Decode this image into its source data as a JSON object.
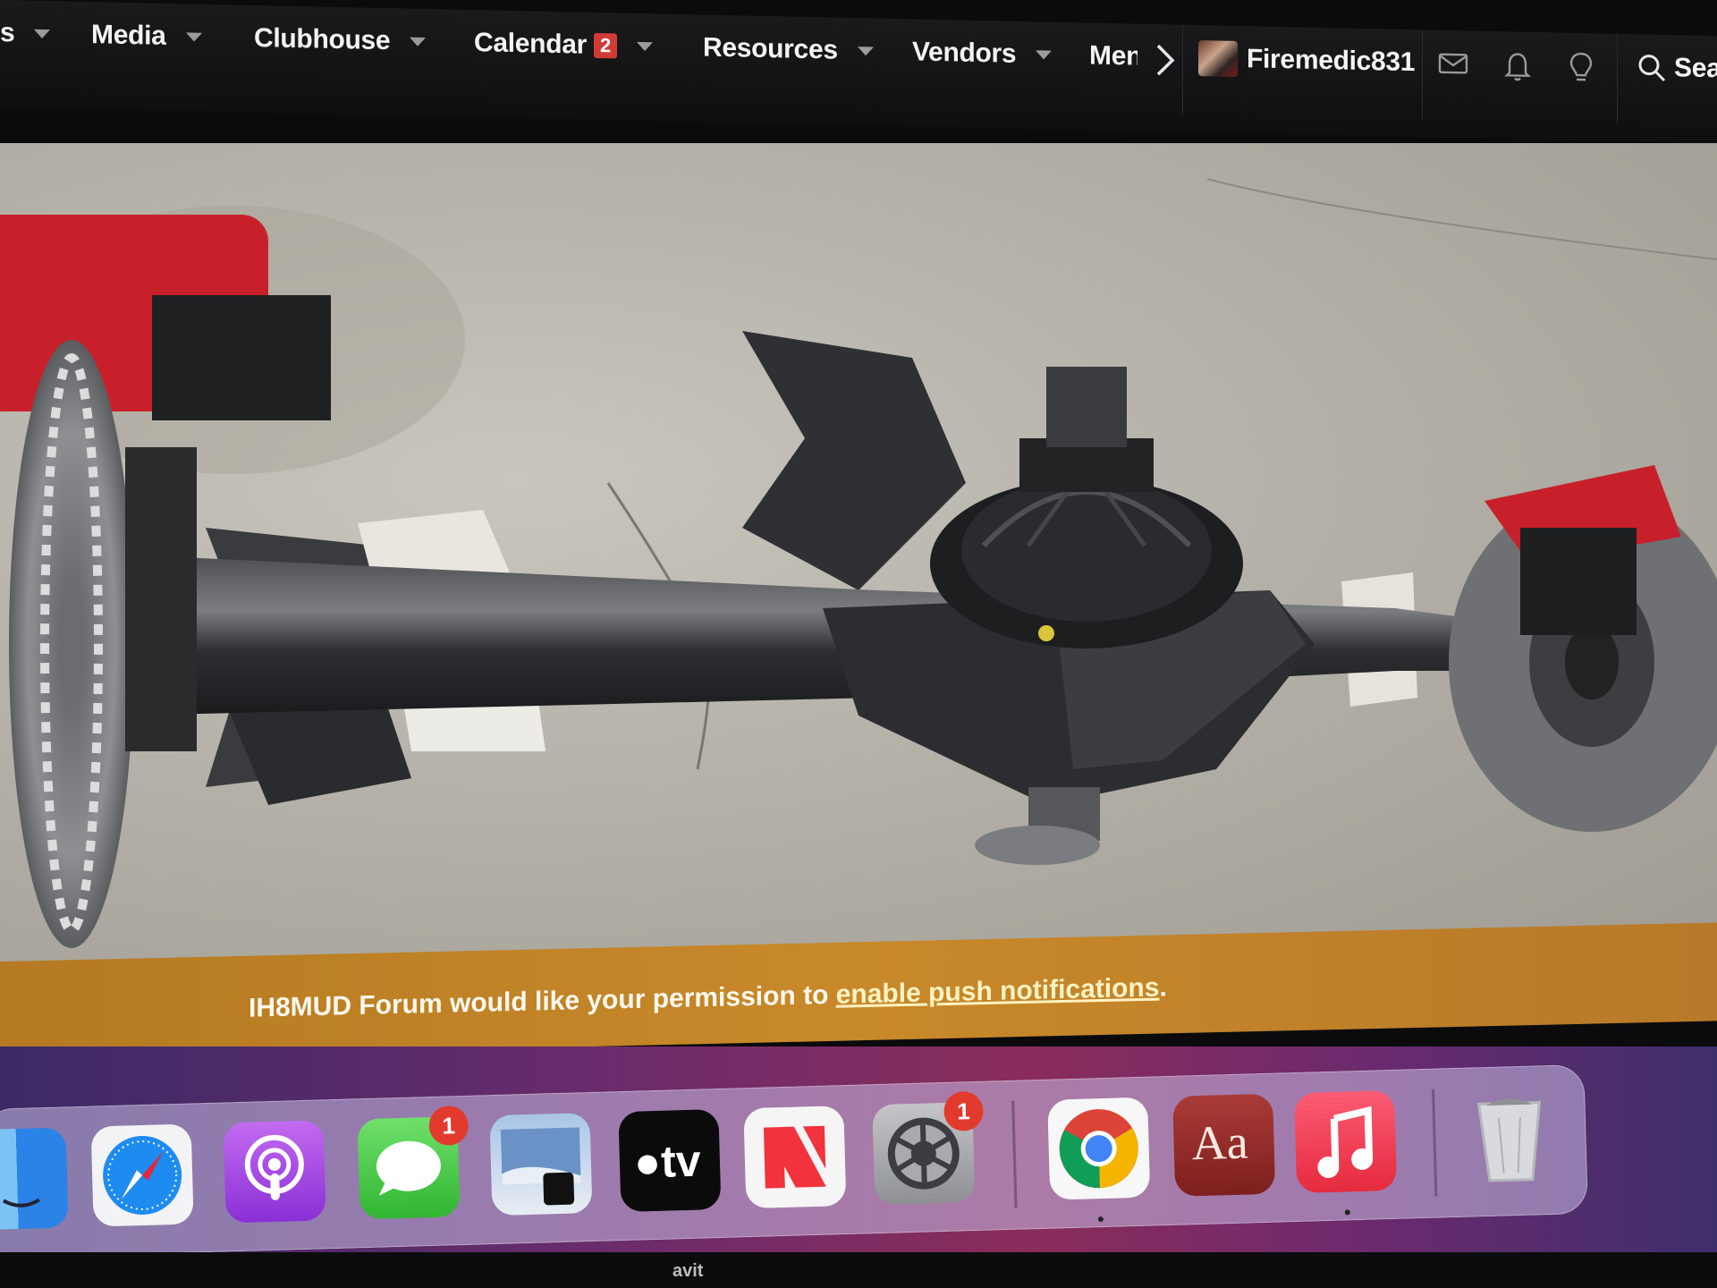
{
  "nav": {
    "items": [
      {
        "label": "s",
        "has_caret": true
      },
      {
        "label": "Media",
        "has_caret": true
      },
      {
        "label": "Clubhouse",
        "has_caret": true
      },
      {
        "label": "Calendar",
        "badge": "2",
        "has_caret": true
      },
      {
        "label": "Resources",
        "has_caret": true
      },
      {
        "label": "Vendors",
        "has_caret": true
      },
      {
        "label": "Men"
      }
    ],
    "username": "Firemedic831",
    "search_label": "Sea",
    "icons": [
      "chevron-right-icon",
      "envelope-icon",
      "bell-icon",
      "lightbulb-icon",
      "search-icon"
    ]
  },
  "hero": {
    "subject": "axle photo",
    "colors": {
      "caliper": "#c8202a",
      "floor": "#b7b3aa",
      "axle": "#2a2b2e"
    }
  },
  "banner": {
    "prefix": "IH8MUD Forum would like your permission to ",
    "link": "enable push notifications",
    "suffix": ".",
    "color": "#c2852a"
  },
  "dock": {
    "apps": [
      {
        "name": "finder-icon"
      },
      {
        "name": "safari-icon"
      },
      {
        "name": "podcasts-icon"
      },
      {
        "name": "messages-icon",
        "badge": "1"
      },
      {
        "name": "preview-icon"
      },
      {
        "name": "apple-tv-icon",
        "label": "tv"
      },
      {
        "name": "news-icon"
      },
      {
        "name": "system-settings-icon",
        "badge": "1"
      },
      {
        "name": "chrome-icon"
      },
      {
        "name": "dictionary-icon",
        "label": "Aa"
      },
      {
        "name": "music-icon"
      },
      {
        "name": "trash-icon"
      }
    ]
  },
  "bezel_label": "avit"
}
